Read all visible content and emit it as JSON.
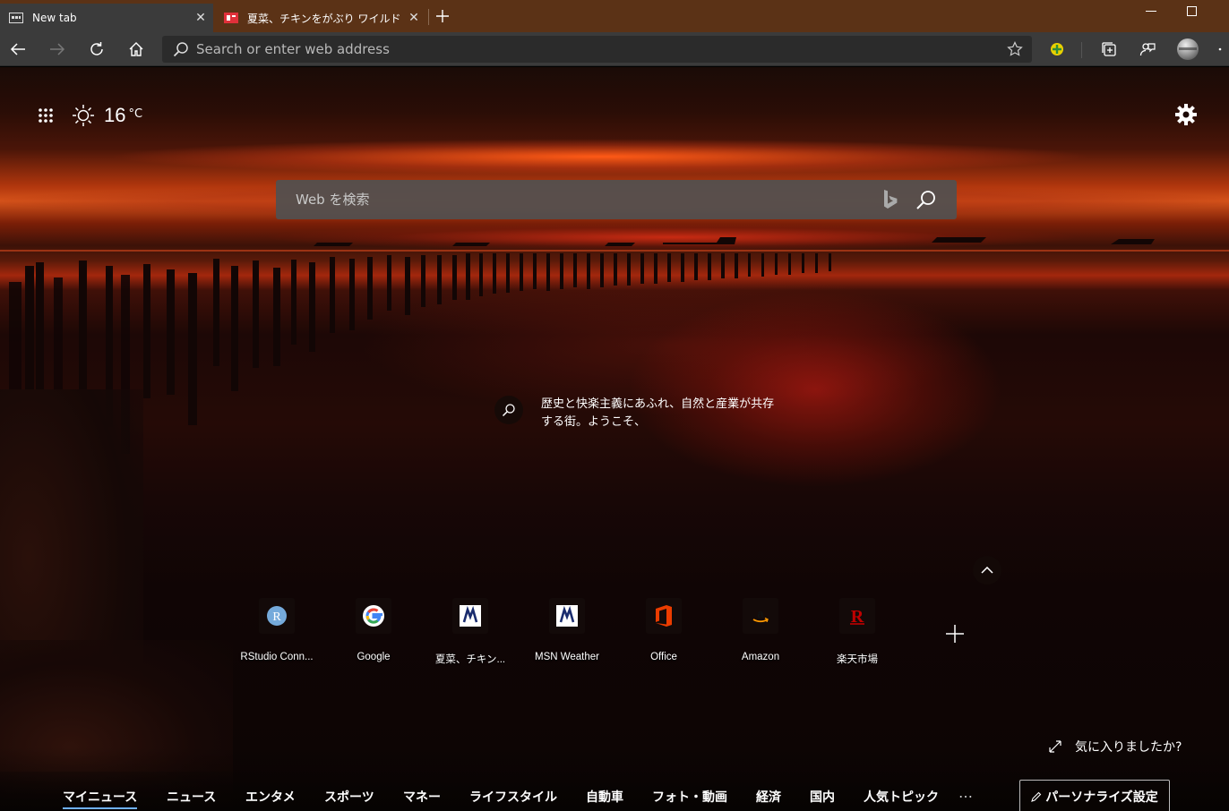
{
  "tabs": [
    {
      "title": "New tab",
      "close": "✕"
    },
    {
      "title": "夏菜、チキンをがぶり ワイルドな食べ…",
      "close": "✕"
    }
  ],
  "new_tab": "+",
  "window_controls": {
    "minimize": "—",
    "maximize": "☐"
  },
  "address_bar": {
    "placeholder": "Search or enter web address"
  },
  "weather": {
    "temperature": "16",
    "unit": "°C",
    "icon": "sun-icon"
  },
  "web_search": {
    "placeholder": "Web を検索"
  },
  "image_info": {
    "text": "歴史と快楽主義にあふれ、自然と産業が共存する街。ようこそ、"
  },
  "quick_links": [
    {
      "label": "RStudio Conn...",
      "icon": "rstudio-icon"
    },
    {
      "label": "Google",
      "icon": "google-icon"
    },
    {
      "label": "夏菜、チキン...",
      "icon": "msn-icon"
    },
    {
      "label": "MSN Weather",
      "icon": "msn-icon"
    },
    {
      "label": "Office",
      "icon": "office-icon"
    },
    {
      "label": "Amazon",
      "icon": "amazon-icon"
    },
    {
      "label": "楽天市場",
      "icon": "rakuten-icon"
    }
  ],
  "add_link": "+",
  "feedback": {
    "text": "気に入りましたか?"
  },
  "news_tabs": [
    "マイニュース",
    "ニュース",
    "エンタメ",
    "スポーツ",
    "マネー",
    "ライフスタイル",
    "自動車",
    "フォト・動画",
    "経済",
    "国内",
    "人気トピック"
  ],
  "news_more": "…",
  "personalize": {
    "label": "パーソナライズ設定"
  },
  "colors": {
    "accent": "#6fb1ff",
    "tabstrip": "#5b3216",
    "toolbar": "#3b3b3b"
  }
}
